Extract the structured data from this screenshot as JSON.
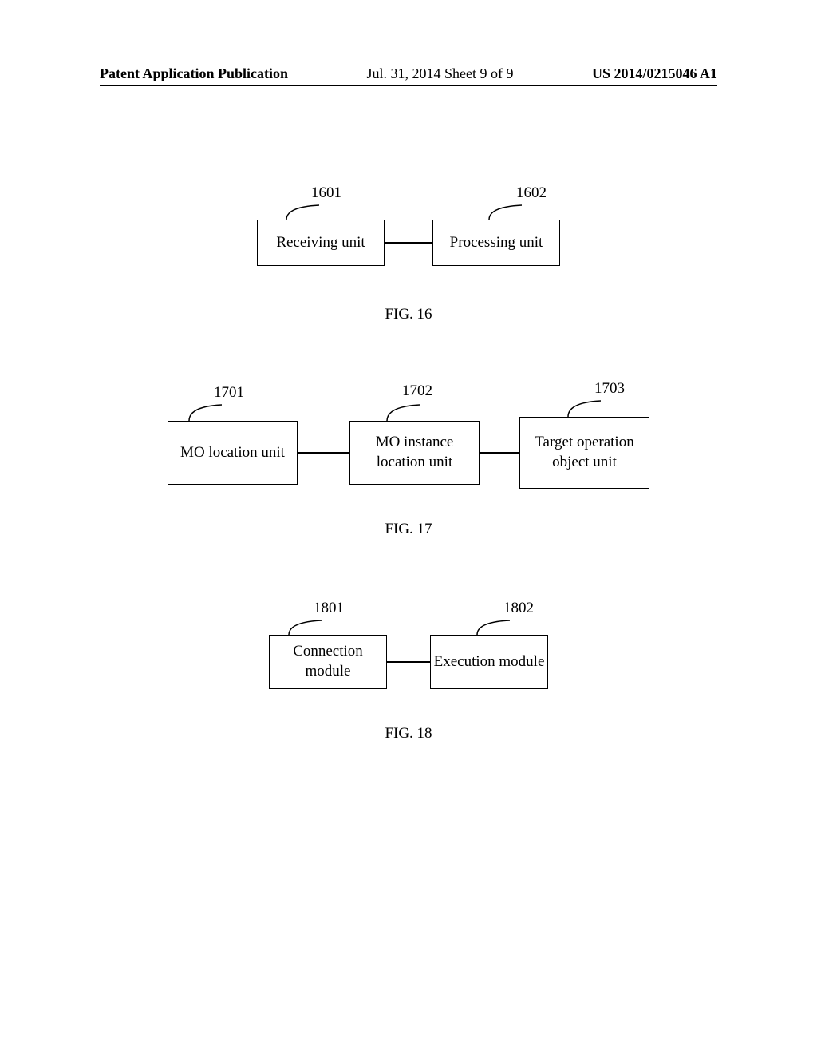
{
  "header": {
    "left": "Patent Application Publication",
    "center": "Jul. 31, 2014  Sheet 9 of 9",
    "right": "US 2014/0215046 A1"
  },
  "fig16": {
    "ref1": "1601",
    "ref2": "1602",
    "box1": "Receiving unit",
    "box2": "Processing unit",
    "caption": "FIG. 16"
  },
  "fig17": {
    "ref1": "1701",
    "ref2": "1702",
    "ref3": "1703",
    "box1": "MO location unit",
    "box2": "MO instance location unit",
    "box3": "Target operation object unit",
    "caption": "FIG. 17"
  },
  "fig18": {
    "ref1": "1801",
    "ref2": "1802",
    "box1": "Connection module",
    "box2": "Execution module",
    "caption": "FIG. 18"
  }
}
